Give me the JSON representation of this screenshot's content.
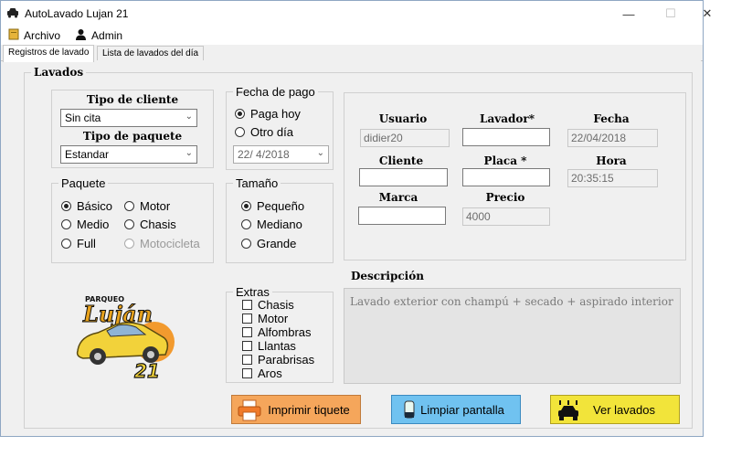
{
  "window": {
    "title": "AutoLavado Lujan 21",
    "minimize_glyph": "—",
    "maximize_glyph": "☐",
    "close_glyph": "✕"
  },
  "menu": [
    {
      "label": "Archivo",
      "icon": "folder-icon"
    },
    {
      "label": "Admin",
      "icon": "user-icon"
    }
  ],
  "tabs": [
    {
      "label": "Registros de lavado",
      "active": true
    },
    {
      "label": "Lista de lavados del día",
      "active": false
    }
  ],
  "lavados": {
    "title": "Lavados",
    "tipo_cliente": {
      "label": "Tipo de cliente",
      "value": "Sin cita"
    },
    "tipo_paquete": {
      "label": "Tipo de paquete",
      "value": "Estandar"
    },
    "fecha_pago": {
      "title": "Fecha de pago",
      "options": [
        {
          "label": "Paga hoy",
          "selected": true
        },
        {
          "label": "Otro día",
          "selected": false
        }
      ],
      "date_value": "22/ 4/2018"
    },
    "paquete": {
      "title": "Paquete",
      "options": [
        {
          "label": "Básico",
          "selected": true,
          "enabled": true
        },
        {
          "label": "Motor",
          "selected": false,
          "enabled": true
        },
        {
          "label": "Medio",
          "selected": false,
          "enabled": true
        },
        {
          "label": "Chasis",
          "selected": false,
          "enabled": true
        },
        {
          "label": "Full",
          "selected": false,
          "enabled": true
        },
        {
          "label": "Motocicleta",
          "selected": false,
          "enabled": false
        }
      ]
    },
    "tamano": {
      "title": "Tamaño",
      "options": [
        {
          "label": "Pequeño",
          "selected": true
        },
        {
          "label": "Mediano",
          "selected": false
        },
        {
          "label": "Grande",
          "selected": false
        }
      ]
    },
    "extras": {
      "title": "Extras",
      "items": [
        "Chasis",
        "Motor",
        "Alfombras",
        "Llantas",
        "Parabrisas",
        "Aros"
      ]
    },
    "info": {
      "usuario_label": "Usuario",
      "usuario_value": "didier20",
      "lavador_label": "Lavador*",
      "lavador_value": "",
      "fecha_label": "Fecha",
      "fecha_value": "22/04/2018",
      "cliente_label": "Cliente",
      "cliente_value": "",
      "placa_label": "Placa *",
      "placa_value": "",
      "hora_label": "Hora",
      "hora_value": "20:35:15",
      "marca_label": "Marca",
      "marca_value": "",
      "precio_label": "Precio",
      "precio_value": "4000"
    },
    "descripcion": {
      "label": "Descripción",
      "text": "Lavado exterior con champú + secado + aspirado interior"
    },
    "logo": {
      "top_text": "PARQUEO",
      "name": "Luján",
      "number": "21"
    }
  },
  "buttons": {
    "imprimir": {
      "label": "Imprimir tiquete",
      "color": "#f5a65b"
    },
    "limpiar": {
      "label": "Limpiar pantalla",
      "color": "#70c2f0"
    },
    "ver": {
      "label": "Ver lavados",
      "color": "#f2e43a"
    }
  }
}
